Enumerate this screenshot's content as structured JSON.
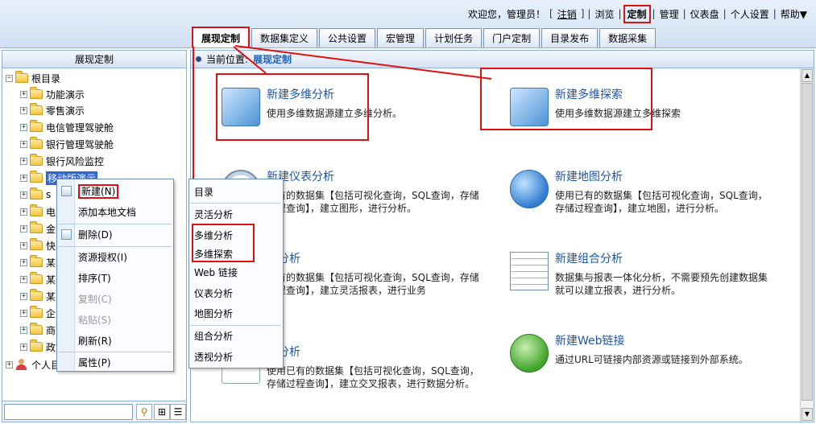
{
  "header": {
    "welcome": "欢迎您，管理员！",
    "logout": "注销",
    "nav": [
      {
        "label": "浏览",
        "active": false
      },
      {
        "label": "定制",
        "active": true
      },
      {
        "label": "管理",
        "active": false
      },
      {
        "label": "仪表盘",
        "active": false
      },
      {
        "label": "个人设置",
        "active": false
      },
      {
        "label": "帮助▼",
        "active": false
      }
    ],
    "tabs": [
      "展现定制",
      "数据集定义",
      "公共设置",
      "宏管理",
      "计划任务",
      "门户定制",
      "目录发布",
      "数据采集"
    ],
    "active_tab": "展现定制"
  },
  "left": {
    "title": "展现定制",
    "tree": {
      "root": "根目录",
      "items": [
        "功能演示",
        "零售演示",
        "电信管理驾驶舱",
        "银行管理驾驶舱",
        "银行风险监控",
        "移动版演示",
        "s",
        "电",
        "金",
        "快",
        "某",
        "某",
        "某",
        "企",
        "商",
        "政"
      ],
      "personal": "个人目录"
    },
    "search_placeholder": ""
  },
  "main": {
    "breadcrumb_prefix": "当前位置:",
    "breadcrumb_current": "展现定制",
    "cards": [
      {
        "title": "新建多维分析",
        "desc": "使用多维数据源建立多维分析。",
        "icon": "cube-icon"
      },
      {
        "title": "新建多维探索",
        "desc": "使用多维数据源建立多维探索",
        "icon": "cube-icon"
      },
      {
        "title": "新建仪表分析",
        "desc": "已有的数据集【包括可视化查询，SQL查询，存储过程查询】，建立图形，进行分析。",
        "icon": "gauge-icon"
      },
      {
        "title": "新建地图分析",
        "desc": "使用已有的数据集【包括可视化查询，SQL查询，存储过程查询】，建立地图，进行分析。",
        "icon": "globe-icon"
      },
      {
        "title": "活分析",
        "desc": "已有的数据集【包括可视化查询，SQL查询，存储过程查询】，建立灵活报表，进行业务",
        "icon": "flex-icon"
      },
      {
        "title": "新建组合分析",
        "desc": "数据集与报表一体化分析，不需要预先创建数据集就可以建立报表，进行分析。",
        "icon": "grid-icon"
      },
      {
        "title": "视分析",
        "desc": "使用已有的数据集【包括可视化查询，SQL查询，存储过程查询】，建立交叉报表，进行数据分析。",
        "icon": "sheet-icon"
      },
      {
        "title": "新建Web链接",
        "desc": "通过URL可链接内部资源或链接到外部系统。",
        "icon": "web-icon"
      }
    ]
  },
  "context_menu": {
    "items": [
      {
        "label": "新建(N)",
        "disabled": false
      },
      {
        "label": "添加本地文档",
        "disabled": false
      },
      {
        "label": "删除(D)",
        "disabled": false
      },
      {
        "label": "资源授权(I)",
        "disabled": false
      },
      {
        "label": "排序(T)",
        "disabled": false
      },
      {
        "label": "复制(C)",
        "disabled": true
      },
      {
        "label": "粘贴(S)",
        "disabled": true
      },
      {
        "label": "刷新(R)",
        "disabled": false
      },
      {
        "label": "属性(P)",
        "disabled": false
      }
    ]
  },
  "submenu": {
    "items": [
      "目录",
      "灵活分析",
      "多维分析",
      "多维探索",
      "Web 链接",
      "仪表分析",
      "地图分析",
      "组合分析",
      "透视分析"
    ]
  }
}
